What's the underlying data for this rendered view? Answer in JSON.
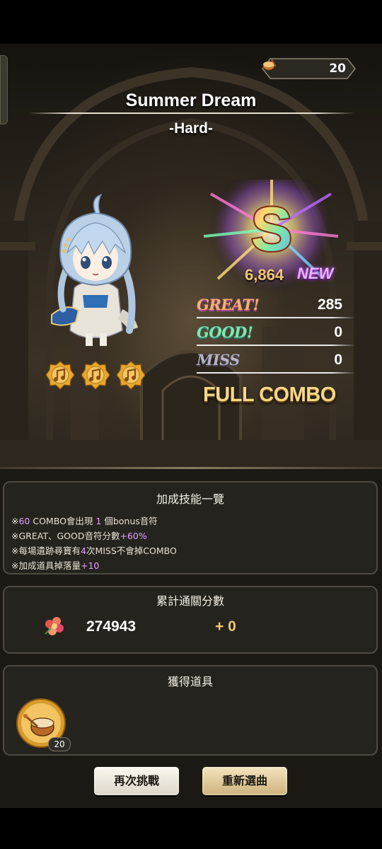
{
  "header": {
    "currency_icon": "drum-token-icon",
    "currency_value": "20"
  },
  "song": {
    "title": "Summer Dream",
    "difficulty": "-Hard-"
  },
  "result": {
    "rank": "S",
    "score": "6,864",
    "new_badge": "NEW",
    "judgements": [
      {
        "label": "GREAT!",
        "value": "285",
        "color": "#f6b16a"
      },
      {
        "label": "GOOD!",
        "value": "0",
        "color": "#7fe6b0"
      },
      {
        "label": "MISS",
        "value": "0",
        "color": "#b6b2c4"
      }
    ],
    "full_combo": "FULL COMBO",
    "medals": [
      "music-note-medal-icon",
      "music-note-medal-icon",
      "music-note-medal-icon"
    ]
  },
  "bonus": {
    "title": "加成技能一覽",
    "lines": [
      {
        "prefix": "※",
        "hl1": "60",
        "mid": " COMBO會出現 ",
        "hl2": "1",
        "suffix": " 個bonus音符"
      },
      {
        "prefix": "※GREAT、GOOD音符分數",
        "hl1": "+60%",
        "mid": "",
        "hl2": "",
        "suffix": ""
      },
      {
        "prefix": "※每場遺跡尋寶有",
        "hl1": "4",
        "mid": "次MISS不會掉COMBO",
        "hl2": "",
        "suffix": ""
      },
      {
        "prefix": "※加成道具掉落量",
        "hl1": "+10",
        "mid": "",
        "hl2": "",
        "suffix": ""
      }
    ]
  },
  "cumulative": {
    "title": "累計通關分數",
    "icon": "flower-icon",
    "score": "274943",
    "gain": "+ 0"
  },
  "items": {
    "title": "獲得道具",
    "item_icon": "drum-item-icon",
    "count": "20"
  },
  "buttons": {
    "retry": "再次挑戰",
    "reselect": "重新選曲"
  },
  "colors": {
    "accent_gold": "#f0c772",
    "highlight_purple": "#e0a2ff",
    "panel_bg": "#25231e"
  }
}
